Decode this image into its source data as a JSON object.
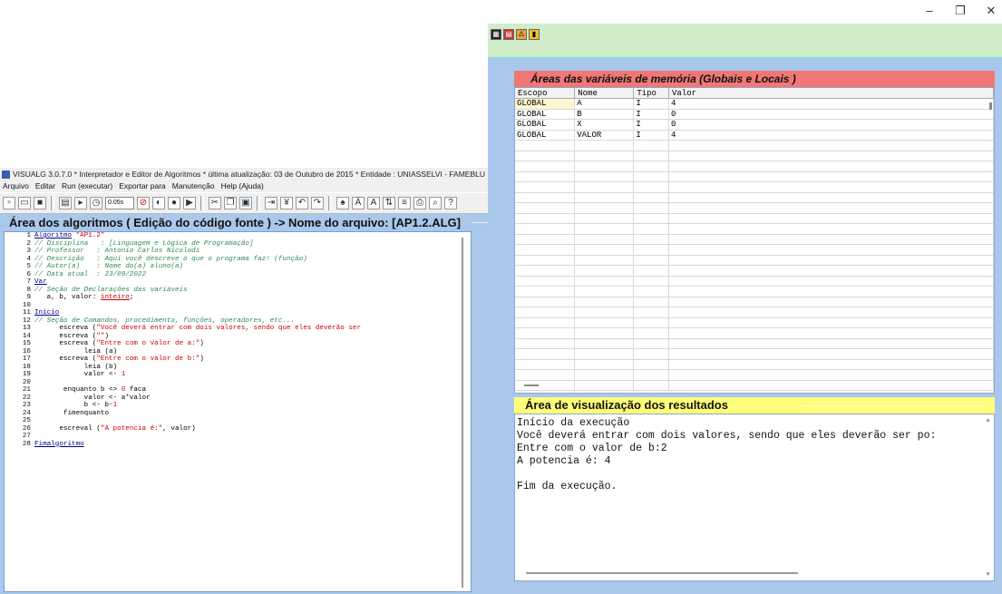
{
  "window_controls": {
    "minimize": "–",
    "restore": "❐",
    "close": "✕"
  },
  "editor": {
    "title": "VISUALG 3.0.7.0 * Interpretador e Editor de Algoritmos * última atualização: 03 de Outubro de 2015 * Entidade : UNIASSELVI - FAMEBLU",
    "menu": [
      "Arquivo",
      "Editar",
      "Run (executar)",
      "Exportar para",
      "Manutenção",
      "Help (Ajuda)"
    ],
    "speed": "0.05s",
    "header": "Área dos algoritmos ( Edição do código fonte ) -> Nome do arquivo: [AP1.2.ALG]",
    "lines": [
      {
        "n": "1",
        "t": "Algoritmo \"AP1.2\"",
        "k": "head"
      },
      {
        "n": "2",
        "t": "// Disciplina   : [Linguagem e Lógica de Programação]",
        "k": "cm"
      },
      {
        "n": "3",
        "t": "// Professor   : Antonio Carlos Nicolodi",
        "k": "cm"
      },
      {
        "n": "4",
        "t": "// Descrição   : Aqui você descreve o que o programa faz! (função)",
        "k": "cm"
      },
      {
        "n": "5",
        "t": "// Autor(a)    : Nome do(a) aluno(a)",
        "k": "cm"
      },
      {
        "n": "6",
        "t": "// Data atual  : 23/09/2022",
        "k": "cm"
      },
      {
        "n": "7",
        "t": "Var",
        "k": "kw"
      },
      {
        "n": "8",
        "t": "// Seção de Declarações das variáveis",
        "k": "cm"
      },
      {
        "n": "9",
        "t": "   a, b, valor: inteiro;",
        "k": "decl"
      },
      {
        "n": "10",
        "t": "",
        "k": "plain"
      },
      {
        "n": "11",
        "t": "Inicio",
        "k": "kw"
      },
      {
        "n": "12",
        "t": "// Seção de Comandos, procedimento, funções, operadores, etc...",
        "k": "cm"
      },
      {
        "n": "13",
        "t": "      escreva (\"Você deverá entrar com dois valores, sendo que eles deverão ser",
        "k": "str"
      },
      {
        "n": "14",
        "t": "      escreva (\"\")",
        "k": "str"
      },
      {
        "n": "15",
        "t": "      escreva (\"Entre com o valor de a:\")",
        "k": "str"
      },
      {
        "n": "16",
        "t": "            leia (a)",
        "k": "plain"
      },
      {
        "n": "17",
        "t": "      escreva (\"Entre com o valor de b:\")",
        "k": "str"
      },
      {
        "n": "18",
        "t": "            leia (b)",
        "k": "plain"
      },
      {
        "n": "19",
        "t": "            valor <- 1",
        "k": "num"
      },
      {
        "n": "20",
        "t": "",
        "k": "plain"
      },
      {
        "n": "21",
        "t": "       enquanto b <> 0 faca",
        "k": "num"
      },
      {
        "n": "22",
        "t": "            valor <- a*valor",
        "k": "plain"
      },
      {
        "n": "23",
        "t": "            b <- b-1",
        "k": "num"
      },
      {
        "n": "24",
        "t": "       fimenquanto",
        "k": "plain"
      },
      {
        "n": "25",
        "t": "",
        "k": "plain"
      },
      {
        "n": "26",
        "t": "      escreval (\"A potencia é:\", valor)",
        "k": "str"
      },
      {
        "n": "27",
        "t": "",
        "k": "plain"
      },
      {
        "n": "28",
        "t": "Fimalgoritmo",
        "k": "kw"
      }
    ]
  },
  "memory": {
    "header": "Áreas das variáveis de memória (Globais e Locais )",
    "columns": [
      "Escopo",
      "Nome",
      "Tipo",
      "Valor"
    ],
    "rows": [
      [
        "GLOBAL",
        "A",
        "I",
        "4"
      ],
      [
        "GLOBAL",
        "B",
        "I",
        "0"
      ],
      [
        "GLOBAL",
        "X",
        "I",
        "0"
      ],
      [
        "GLOBAL",
        "VALOR",
        "I",
        "4"
      ]
    ]
  },
  "output": {
    "header": "Área de visualização dos resultados",
    "lines": [
      "Início da execução",
      "Você deverá entrar com dois valores, sendo que eles deverão ser po:",
      "Entre com o valor de b:2",
      "A potencia é: 4",
      "",
      "Fim da execução."
    ]
  }
}
